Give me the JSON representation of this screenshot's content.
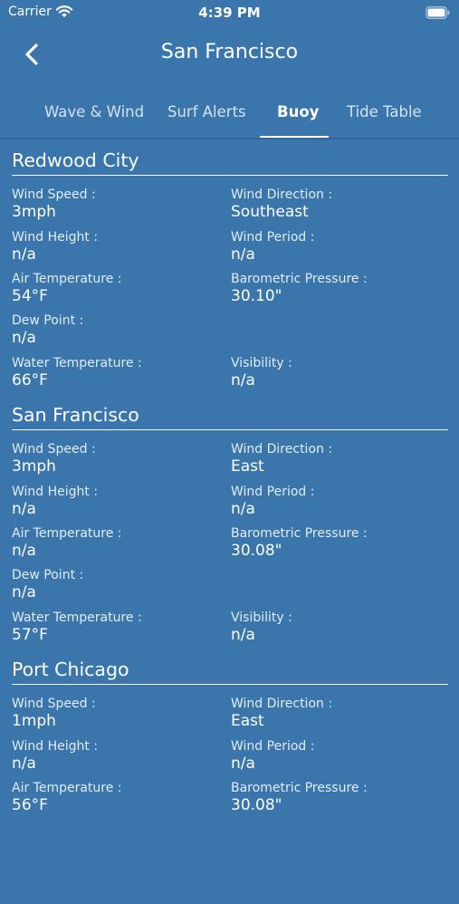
{
  "status_bar": {
    "carrier": "Carrier",
    "time": "4:39 PM"
  },
  "header": {
    "title": "San Francisco"
  },
  "tabs": [
    {
      "label": "Wave & Wind"
    },
    {
      "label": "Surf Alerts"
    },
    {
      "label": "Buoy"
    },
    {
      "label": "Tide Table"
    }
  ],
  "labels": {
    "wind_speed": "Wind Speed :",
    "wind_direction": "Wind Direction :",
    "wind_height": "Wind Height :",
    "wind_period": "Wind Period :",
    "air_temperature": "Air Temperature :",
    "barometric_pressure": "Barometric Pressure :",
    "dew_point": "Dew Point :",
    "water_temperature": "Water Temperature :",
    "visibility": "Visibility :"
  },
  "stations": [
    {
      "name": "Redwood City",
      "wind_speed": "3mph",
      "wind_direction": "Southeast",
      "wind_height": "n/a",
      "wind_period": "n/a",
      "air_temperature": "54°F",
      "barometric_pressure": "30.10\"",
      "dew_point": "n/a",
      "water_temperature": "66°F",
      "visibility": "n/a"
    },
    {
      "name": "San Francisco",
      "wind_speed": "3mph",
      "wind_direction": "East",
      "wind_height": "n/a",
      "wind_period": "n/a",
      "air_temperature": "n/a",
      "barometric_pressure": "30.08\"",
      "dew_point": "n/a",
      "water_temperature": "57°F",
      "visibility": "n/a"
    },
    {
      "name": "Port Chicago",
      "wind_speed": "1mph",
      "wind_direction": "East",
      "wind_height": "n/a",
      "wind_period": "n/a",
      "air_temperature": "56°F",
      "barometric_pressure": "30.08\""
    }
  ]
}
